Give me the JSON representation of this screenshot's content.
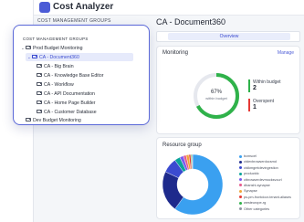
{
  "app": {
    "title": "Cost Analyzer",
    "groups_heading": "COST MANAGEMENT GROUPS"
  },
  "page": {
    "title": "CA - Document360",
    "tabs": [
      {
        "label": "Overview",
        "active": true
      }
    ]
  },
  "monitoring": {
    "label": "Monitoring",
    "manage_label": "Manage",
    "gauge_percent_text": "67%",
    "gauge_sub": "within budget",
    "gauge_fraction": 0.67,
    "within_budget": {
      "label": "Within budget",
      "value": "2",
      "color": "#2fb24a"
    },
    "overspent": {
      "label": "Overspent",
      "value": "1",
      "color": "#e53935"
    }
  },
  "resource_group": {
    "label": "Resource group",
    "items": [
      {
        "name": "bcmscel",
        "color": "#3aa0f0",
        "share": 0.6
      },
      {
        "name": "ctdevbrowserdocsmd",
        "color": "#1e2a8c",
        "share": 0.22
      },
      {
        "name": "ctdkmgmtdevingestion",
        "color": "#3b4bd0",
        "share": 0.08
      },
      {
        "name": "productdc",
        "color": "#0aa39a",
        "share": 0.03
      },
      {
        "name": "ctbrowserdevmocksvcurl",
        "color": "#7a5cf0",
        "share": 0.02
      },
      {
        "name": "dhanshl-synapse",
        "color": "#e65a8c",
        "share": 0.015
      },
      {
        "name": "Synapse",
        "color": "#f0a63a",
        "share": 0.015
      },
      {
        "name": "ps-pm-frontdoor-tenant-aliases",
        "color": "#e53935",
        "share": 0.01
      },
      {
        "name": "westeurope-rg",
        "color": "#2fb24a",
        "share": 0.005
      },
      {
        "name": "Other categories",
        "color": "#8f96a3",
        "share": 0.005
      }
    ]
  },
  "panel": {
    "heading": "COST MANAGEMENT GROUPS",
    "items": [
      {
        "label": "Prod Budget Monitoring",
        "chevron": "⌄",
        "folder": true
      },
      {
        "label": "CA - Document360",
        "chevron": "⌄",
        "folder": true,
        "selected": true
      },
      {
        "label": "CA - Big Brain",
        "chevron": "",
        "folder": true
      },
      {
        "label": "CA - Knowledge Base Editor",
        "chevron": "",
        "folder": true
      },
      {
        "label": "CA - Workflow",
        "chevron": "",
        "folder": true
      },
      {
        "label": "CA - API Documentation",
        "chevron": "",
        "folder": true
      },
      {
        "label": "CA - Home Page Builder",
        "chevron": "",
        "folder": true
      },
      {
        "label": "CA - Customer Database",
        "chevron": "",
        "folder": true
      },
      {
        "label": "Dev Budget Monitoring",
        "chevron": "",
        "folder": true
      }
    ]
  }
}
